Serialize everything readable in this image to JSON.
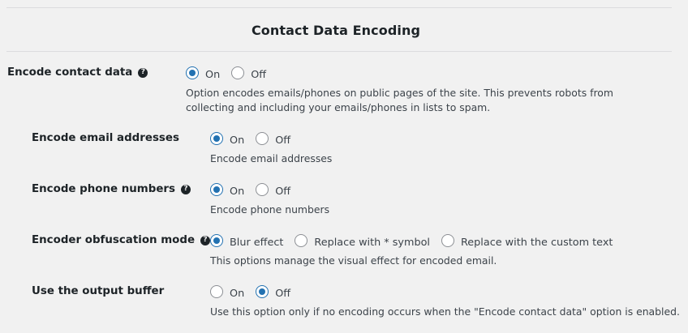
{
  "section": {
    "title": "Contact Data Encoding"
  },
  "colors": {
    "accent": "#2271b1",
    "background": "#f1f1f1",
    "heading": "#1d2327",
    "text": "#3c434a"
  },
  "settings": [
    {
      "label": "Encode contact data",
      "has_help": true,
      "options": [
        {
          "label": "On",
          "checked": true
        },
        {
          "label": "Off",
          "checked": false
        }
      ],
      "description": "Option encodes emails/phones on public pages of the site. This prevents robots from collecting and including your emails/phones in lists to spam."
    },
    {
      "label": "Encode email addresses",
      "has_help": false,
      "options": [
        {
          "label": "On",
          "checked": true
        },
        {
          "label": "Off",
          "checked": false
        }
      ],
      "description": "Encode email addresses"
    },
    {
      "label": "Encode phone numbers",
      "has_help": true,
      "options": [
        {
          "label": "On",
          "checked": true
        },
        {
          "label": "Off",
          "checked": false
        }
      ],
      "description": "Encode phone numbers"
    },
    {
      "label": "Encoder obfuscation mode",
      "has_help": true,
      "options": [
        {
          "label": "Blur effect",
          "checked": true
        },
        {
          "label": "Replace with * symbol",
          "checked": false
        },
        {
          "label": "Replace with the custom text",
          "checked": false
        }
      ],
      "description": "This options manage the visual effect for encoded email."
    },
    {
      "label": "Use the output buffer",
      "has_help": false,
      "options": [
        {
          "label": "On",
          "checked": false
        },
        {
          "label": "Off",
          "checked": true
        }
      ],
      "description": "Use this option only if no encoding occurs when the \"Encode contact data\" option is enabled."
    }
  ]
}
